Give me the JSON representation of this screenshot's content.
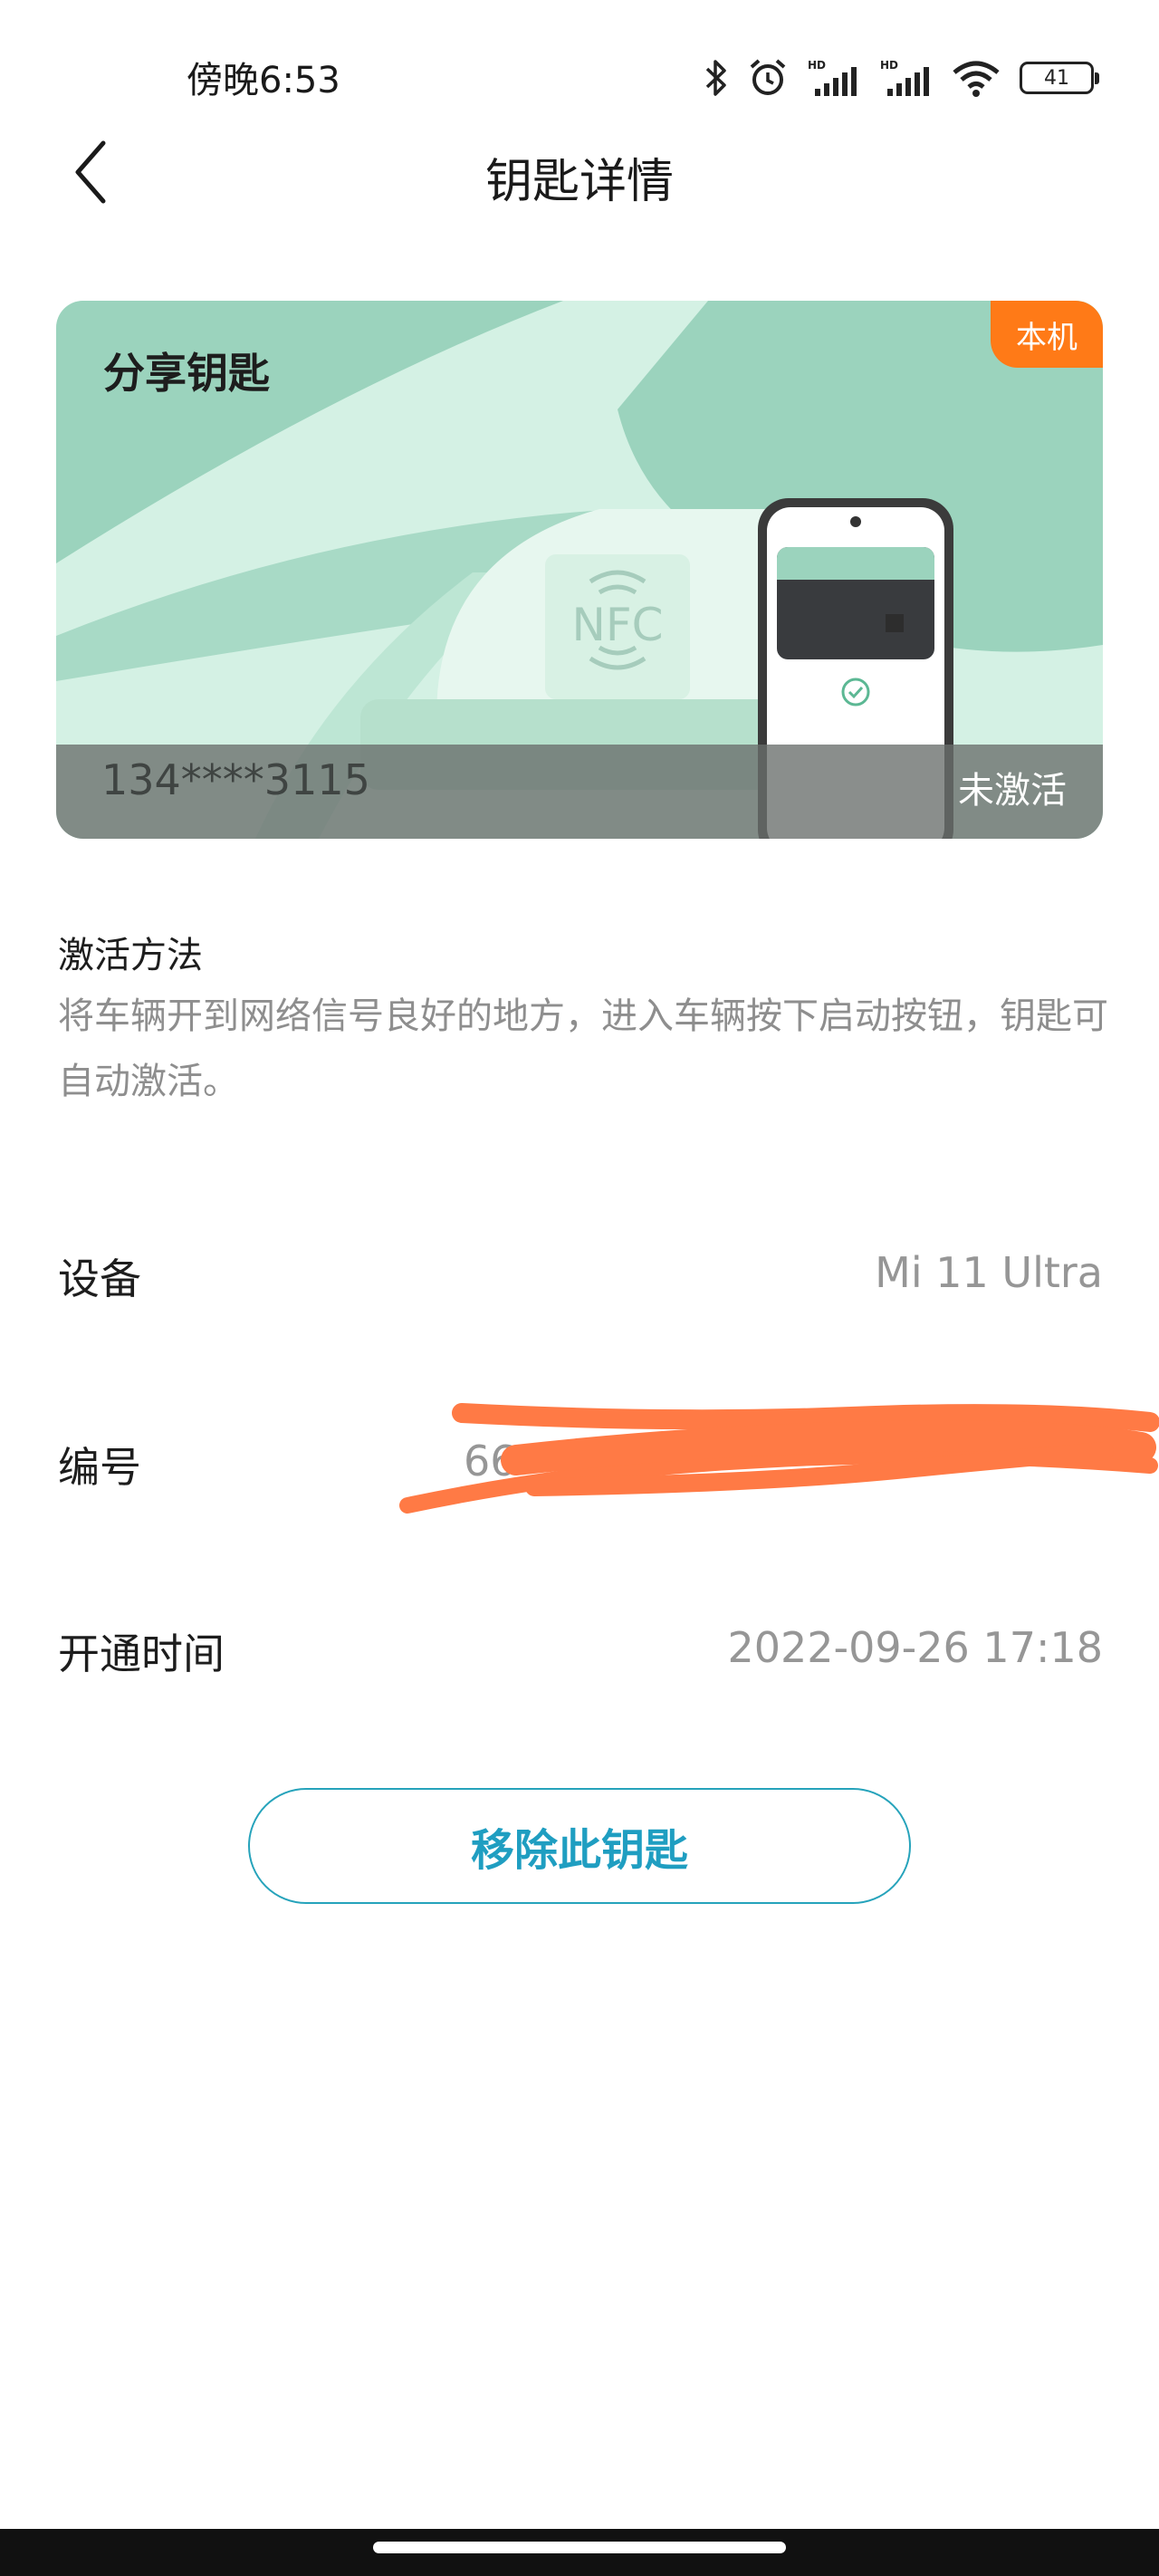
{
  "status_bar": {
    "time": "傍晚6:53",
    "battery": "41",
    "icons": [
      "bluetooth-icon",
      "alarm-icon",
      "hd-signal-icon",
      "hd-signal-icon",
      "wifi-icon",
      "battery-icon"
    ]
  },
  "header": {
    "title": "钥匙详情",
    "back_icon": "chevron-left-icon"
  },
  "card": {
    "title": "分享钥匙",
    "badge": "本机",
    "nfc_label": "NFC",
    "number": "134****3115",
    "status": "未激活",
    "colors": {
      "accent": "#9bd3bd",
      "badge": "#ff7a17"
    }
  },
  "activation": {
    "title": "激活方法",
    "description": "将车辆开到网络信号良好的地方，进入车辆按下启动按钮，钥匙可自动激活。"
  },
  "info": {
    "device_label": "设备",
    "device_value": "Mi 11 Ultra",
    "serial_label": "编号",
    "serial_value": "66",
    "time_label": "开通时间",
    "time_value": "2022-09-26 17:18"
  },
  "actions": {
    "remove_label": "移除此钥匙",
    "accent_color": "#1f9ec1"
  }
}
